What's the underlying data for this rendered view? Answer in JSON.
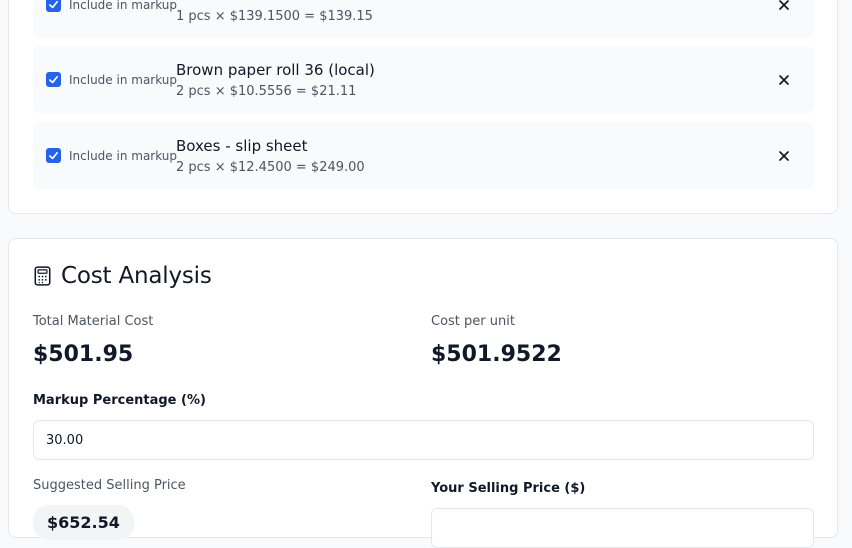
{
  "materials": {
    "items": [
      {
        "checkbox_label": "Include in markup",
        "checked": true,
        "name": "",
        "calc": "1 pcs × $139.1500 = $139.15"
      },
      {
        "checkbox_label": "Include in markup",
        "checked": true,
        "name": "Brown paper roll 36 (local)",
        "calc": "2 pcs × $10.5556 = $21.11"
      },
      {
        "checkbox_label": "Include in markup",
        "checked": true,
        "name": "Boxes - slip sheet",
        "calc": "2 pcs × $12.4500 = $249.00"
      }
    ],
    "remove_icon": "close-icon"
  },
  "analysis": {
    "title": "Cost Analysis",
    "title_icon": "calculator-icon",
    "total_material_cost_label": "Total Material Cost",
    "total_material_cost": "$501.95",
    "cost_per_unit_label": "Cost per unit",
    "cost_per_unit": "$501.9522",
    "markup_label": "Markup Percentage (%)",
    "markup_value": "30.00",
    "suggested_price_label": "Suggested Selling Price",
    "suggested_price": "$652.54",
    "your_price_label": "Your Selling Price ($)",
    "your_price_value": ""
  },
  "colors": {
    "accent": "#2563eb",
    "page_background": "#f9fafb",
    "card_background": "#ffffff",
    "item_background": "#f9fafb",
    "border": "#e5e7eb",
    "text_primary": "#111827",
    "text_secondary": "#4b5563"
  }
}
